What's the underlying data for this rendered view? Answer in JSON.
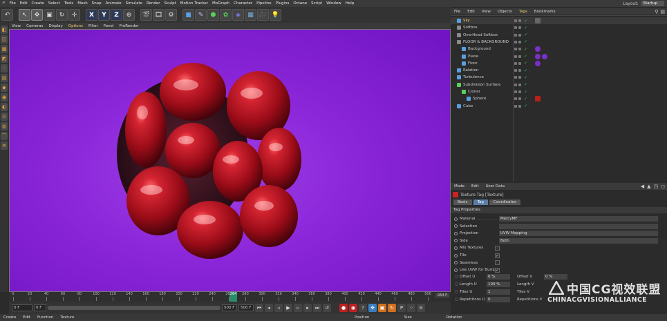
{
  "menubar": {
    "items": [
      "File",
      "Edit",
      "Create",
      "Select",
      "Tools",
      "Mesh",
      "Snap",
      "Animate",
      "Simulate",
      "Render",
      "Sculpt",
      "Motion Tracker",
      "MoGraph",
      "Character",
      "Pipeline",
      "Plugins",
      "Octane",
      "Script",
      "Window",
      "Help"
    ],
    "layout_label": "Layout:",
    "layout_value": "Startup"
  },
  "toolbar": {
    "axis_x": "X",
    "axis_y": "Y",
    "axis_z": "Z"
  },
  "viewport": {
    "menu": [
      "View",
      "Cameras",
      "Display",
      "Options",
      "Filter",
      "Panel",
      "ProRender"
    ],
    "active_menu": "Options"
  },
  "timeline": {
    "ticks": [
      0,
      20,
      40,
      60,
      80,
      100,
      120,
      140,
      160,
      180,
      200,
      220,
      240,
      260,
      280,
      300,
      320,
      340,
      360,
      380,
      400,
      420,
      440,
      460,
      480,
      500
    ],
    "current_frame": "264",
    "end_label": "264 F",
    "max": 500
  },
  "transport": {
    "start_field": "0 F",
    "min_field": "0 F",
    "max_field": "500 F",
    "end_field": "500 F"
  },
  "bottombar": {
    "tabs": [
      "Create",
      "Edit",
      "Function",
      "Texture"
    ],
    "coord_heads": [
      "Position",
      "Size",
      "Rotation"
    ]
  },
  "object_manager": {
    "menu": [
      "File",
      "Edit",
      "View",
      "Objects",
      "Tags",
      "Bookmarks"
    ],
    "active_menu": "Tags",
    "objects": [
      {
        "name": "Sky",
        "indent": 0,
        "color": "#5aa0e0",
        "highlight": true
      },
      {
        "name": "Softbox",
        "indent": 0,
        "color": "#8a8a8a"
      },
      {
        "name": "OverHead Softbox",
        "indent": 0,
        "color": "#8a8a8a"
      },
      {
        "name": "FLOOR & BACKGROUND",
        "indent": 0,
        "color": "#8a8a8a"
      },
      {
        "name": "Background",
        "indent": 1,
        "color": "#5aa0e0"
      },
      {
        "name": "Plane",
        "indent": 1,
        "color": "#5aa0e0"
      },
      {
        "name": "Floor",
        "indent": 1,
        "color": "#5aa0e0"
      },
      {
        "name": "Relation",
        "indent": 0,
        "color": "#5aa0e0"
      },
      {
        "name": "Turbulence",
        "indent": 0,
        "color": "#5aa0e0"
      },
      {
        "name": "Subdivision Surface",
        "indent": 0,
        "color": "#5ad05a"
      },
      {
        "name": "Cloner",
        "indent": 1,
        "color": "#5ad05a"
      },
      {
        "name": "Sphere",
        "indent": 2,
        "color": "#5aa0e0"
      },
      {
        "name": "Cube",
        "indent": 0,
        "color": "#5aa0e0"
      }
    ]
  },
  "attribute_manager": {
    "menu": [
      "Mode",
      "Edit",
      "User Data"
    ],
    "title": "Texture Tag [Texture]",
    "tabs": [
      "Basic",
      "Tag",
      "Coordinates"
    ],
    "active_tab": "Tag",
    "section": "Tag Properties",
    "props": [
      {
        "label": "Material . . . . . . . . .",
        "value": "MercyMF",
        "kind": "field"
      },
      {
        "label": "Selection",
        "value": "",
        "kind": "field"
      },
      {
        "label": "Projection",
        "value": "UVW Mapping",
        "kind": "field"
      },
      {
        "label": "Side",
        "value": "Both",
        "kind": "field"
      },
      {
        "label": "Mix Textures",
        "value": "",
        "kind": "box"
      },
      {
        "label": "Tile",
        "value": "✓",
        "kind": "box"
      },
      {
        "label": "Seamless",
        "value": "",
        "kind": "box"
      },
      {
        "label": "Use UVW for Bump",
        "value": "✓",
        "kind": "box"
      }
    ],
    "offset": {
      "offset_u_label": "Offset U",
      "offset_u_value": "0 %",
      "offset_v_label": "Offset V",
      "offset_v_value": "0 %",
      "length_u_label": "Length U",
      "length_u_value": "100 %",
      "length_v_label": "Length V",
      "tiles_u_label": "Tiles U",
      "tiles_u_value": "1",
      "tiles_v_label": "Tiles V",
      "rep_u_label": "Repetitions U",
      "rep_u_value": "0",
      "rep_v_label": "Repetitions V"
    }
  },
  "watermark": {
    "main": "中国CG视效联盟",
    "sub": "CHINACGVISIONALLIANCE"
  },
  "colors": {
    "viewport_bg": "#8a25d8",
    "blob_red": "#a8101e",
    "accent_blue": "#5a7ea8",
    "playhead": "#2a8a6a"
  }
}
